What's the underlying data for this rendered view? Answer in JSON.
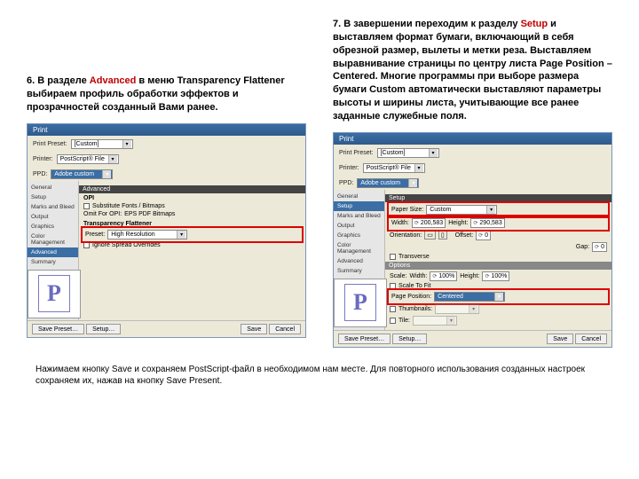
{
  "left": {
    "instruction_pre": "6. В разделе ",
    "instruction_hl": "Advanced",
    "instruction_post": " в меню Transparency Flattener выбираем профиль обработки эффектов и прозрачностей созданный Вами ранее.",
    "dlg": {
      "title": "Print",
      "pp_label": "Print Preset:",
      "pp_value": "[Custom]",
      "pr_label": "Printer:",
      "pr_value": "PostScript® File",
      "ppd_label": "PPD:",
      "ppd_value": "Adobe custom",
      "side_items": [
        "General",
        "Setup",
        "Marks and Bleed",
        "Output",
        "Graphics",
        "Color Management",
        "Advanced",
        "Summary"
      ],
      "side_sel": "Advanced",
      "pane_title": "Advanced",
      "opi_label": "OPI",
      "sub_cb": "Substitute Fonts / Bitmaps",
      "omit_label": "Omit For OPI:",
      "omit_vals": "EPS  PDF  Bitmaps",
      "tf_label": "Transparency Flattener",
      "preset_label": "Preset:",
      "preset_value": "High Resolution",
      "ignore_cb": "Ignore Spread Overrides",
      "save_preset": "Save Preset…",
      "setup_btn": "Setup…",
      "save_btn": "Save",
      "cancel_btn": "Cancel"
    }
  },
  "right": {
    "instruction_pre": "7. В завершении переходим к разделу ",
    "instruction_hl": "Setup",
    "instruction_post": " и выставляем формат бумаги, включающий в себя обрезной размер, вылеты и метки реза. Выставляем выравнивание страницы по центру листа Page Position – Centered. Многие программы при выборе размера бумаги Custom автоматически выставляют параметры высоты и ширины листа, учитывающие все ранее заданные служебные поля.",
    "dlg": {
      "title": "Print",
      "pp_label": "Print Preset:",
      "pp_value": "[Custom]",
      "pr_label": "Printer:",
      "pr_value": "PostScript® File",
      "ppd_label": "PPD:",
      "ppd_value": "Adobe custom",
      "side_items": [
        "General",
        "Setup",
        "Marks and Bleed",
        "Output",
        "Graphics",
        "Color Management",
        "Advanced",
        "Summary"
      ],
      "side_sel": "Setup",
      "pane_title": "Setup",
      "ps_label": "Paper Size:",
      "ps_value": "Custom",
      "w_label": "Width:",
      "w_value": "200,583",
      "h_label": "Height:",
      "h_value": "290,583",
      "orient_label": "Orientation:",
      "offset_label": "Offset:",
      "offset_value": "0",
      "gap_label": "Gap:",
      "gap_value": "0",
      "transverse": "Transverse",
      "options_title": "Options",
      "scale_label": "Scale:",
      "sw_label": "Width:",
      "sw_value": "100%",
      "sh_label": "Height:",
      "sh_value": "100%",
      "stf_cb": "Scale To Fit",
      "pp_pos_label": "Page Position:",
      "pp_pos_value": "Centered",
      "thumb_cb": "Thumbnails:",
      "tile_cb": "Tile:",
      "save_preset": "Save Preset…",
      "setup_btn": "Setup…",
      "save_btn": "Save",
      "cancel_btn": "Cancel"
    }
  },
  "footnote": "Нажимаем кнопку Save и сохраняем PostScript-файл в необходимом нам месте. Для повторного использования созданных настроек сохраняем их, нажав на кнопку Save Present."
}
